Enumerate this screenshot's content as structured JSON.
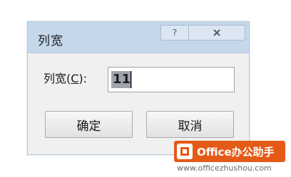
{
  "dialog": {
    "title": "列宽",
    "help_label": "?",
    "field_label_prefix": "列宽(",
    "field_label_accel": "C",
    "field_label_suffix": "):",
    "column_width_value": "11",
    "ok_label": "确定",
    "cancel_label": "取消"
  },
  "icons": {
    "help": "help-icon",
    "close": "close-icon"
  },
  "watermark": {
    "badge_text": "Office办公助手",
    "url": "www.officezhushou.com"
  },
  "colors": {
    "titlebar": "#c5d7ea",
    "dialog_bg": "#f0f0f0",
    "selection": "#9fa5ad",
    "watermark": "#e45a17"
  }
}
